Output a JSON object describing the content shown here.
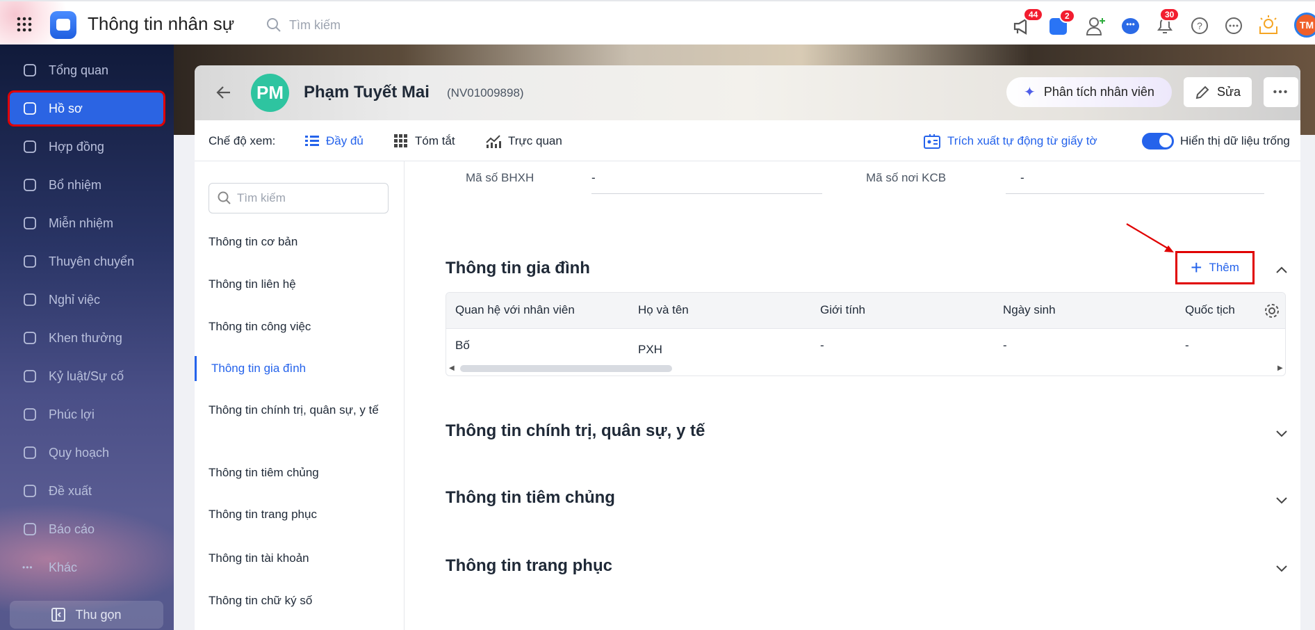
{
  "topbar": {
    "app_title": "Thông tin nhân sự",
    "search_placeholder": "Tìm kiếm",
    "badges": {
      "announcements": "44",
      "cart": "2",
      "notifications": "30"
    },
    "avatar": "TM"
  },
  "sidebar": {
    "items": [
      {
        "label": "Tổng quan"
      },
      {
        "label": "Hồ sơ"
      },
      {
        "label": "Hợp đồng"
      },
      {
        "label": "Bổ nhiệm"
      },
      {
        "label": "Miễn nhiệm"
      },
      {
        "label": "Thuyên chuyển"
      },
      {
        "label": "Nghỉ việc"
      },
      {
        "label": "Khen thưởng"
      },
      {
        "label": "Kỷ luật/Sự cố"
      },
      {
        "label": "Phúc lợi"
      },
      {
        "label": "Quy hoạch"
      },
      {
        "label": "Đề xuất"
      },
      {
        "label": "Báo cáo"
      },
      {
        "label": "Khác"
      }
    ],
    "collapse_label": "Thu gọn"
  },
  "employee": {
    "initials": "PM",
    "name": "Phạm Tuyết Mai",
    "code": "(NV01009898)",
    "analyze_label": "Phân tích nhân viên",
    "edit_label": "Sửa"
  },
  "viewbar": {
    "label": "Chế độ xem:",
    "modes": [
      "Đầy đủ",
      "Tóm tắt",
      "Trực quan"
    ],
    "extract_label": "Trích xuất tự động từ giấy tờ",
    "show_empty_label": "Hiển thị dữ liệu trống",
    "show_empty_on": true
  },
  "leftnav": {
    "search_placeholder": "Tìm kiếm",
    "items": [
      "Thông tin cơ bản",
      "Thông tin liên hệ",
      "Thông tin công việc",
      "Thông tin gia đình",
      "Thông tin chính trị, quân sự, y tế",
      "Thông tin tiêm chủng",
      "Thông tin trang phục",
      "Thông tin tài khoản",
      "Thông tin chữ ký số"
    ]
  },
  "fields": {
    "bhxh_label": "Mã số BHXH",
    "bhxh_value": "-",
    "kcb_label": "Mã số nơi KCB",
    "kcb_value": "-"
  },
  "family": {
    "title": "Thông tin gia đình",
    "add_label": "Thêm",
    "columns": [
      "Quan hệ với nhân viên",
      "Họ và tên",
      "Giới tính",
      "Ngày sinh",
      "Quốc tịch"
    ],
    "rows": [
      [
        "Bố",
        "PXH",
        "-",
        "-",
        "-"
      ]
    ]
  },
  "sections": [
    "Thông tin chính trị, quân sự, y tế",
    "Thông tin tiêm chủng",
    "Thông tin trang phục"
  ],
  "colors": {
    "accent": "#2563eb",
    "annotation": "#e00000",
    "avatar_bg": "#2ec4a0"
  }
}
